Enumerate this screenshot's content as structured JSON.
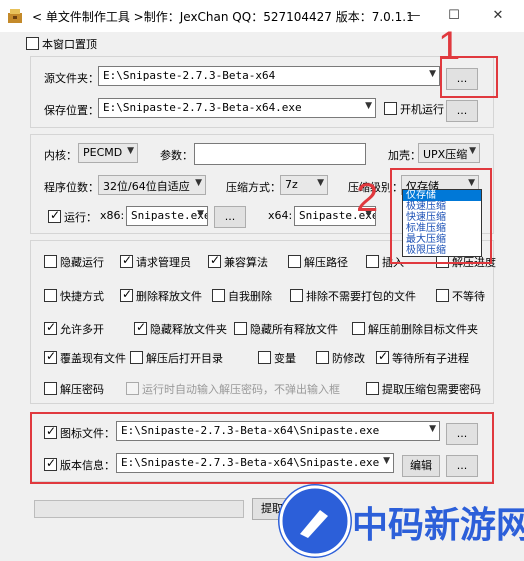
{
  "window": {
    "title": "< 单文件制作工具 >制作：JexChan  QQ：527104427  版本：7.0.1.1",
    "minimize": "—",
    "maximize": "☐",
    "close": "✕"
  },
  "top_option": {
    "label": "本窗口置顶",
    "checked": false
  },
  "source": {
    "label": "源文件夹：",
    "value": "E:\\Snipaste-2.7.3-Beta-x64",
    "browse": "..."
  },
  "save": {
    "label": "保存位置：",
    "value": "E:\\Snipaste-2.7.3-Beta-x64.exe",
    "autorun_label": "开机运行",
    "browse": "..."
  },
  "kernel": {
    "label": "内核：",
    "value": "PECMD"
  },
  "params": {
    "label": "参数：",
    "value": ""
  },
  "shell": {
    "label": "加壳：",
    "value": "UPX压缩"
  },
  "bits": {
    "label": "程序位数：",
    "value": "32位/64位自适应"
  },
  "compress_method": {
    "label": "压缩方式：",
    "value": "7z"
  },
  "compress_level": {
    "label": "压缩级别：",
    "value": "仅存储",
    "options": [
      "仅存储",
      "极速压缩",
      "快速压缩",
      "标准压缩",
      "最大压缩",
      "极限压缩"
    ],
    "selected_index": 0
  },
  "run": {
    "label": "运行：",
    "checked": true,
    "x86_label": "x86:",
    "x86_value": "Snipaste.exe",
    "x64_label": "x64:",
    "x64_value": "Snipaste.exe",
    "browse": "..."
  },
  "options": [
    {
      "label": "隐藏运行",
      "checked": false
    },
    {
      "label": "请求管理员",
      "checked": true
    },
    {
      "label": "兼容算法",
      "checked": true
    },
    {
      "label": "解压路径",
      "checked": false
    },
    {
      "label": "插入",
      "checked": false
    },
    {
      "label": "解压进度",
      "checked": false
    },
    {
      "label": "快捷方式",
      "checked": false
    },
    {
      "label": "删除释放文件",
      "checked": true
    },
    {
      "label": "自我删除",
      "checked": false
    },
    {
      "label": "排除不需要打包的文件",
      "checked": false
    },
    {
      "label": "不等待",
      "checked": false
    },
    {
      "label": "允许多开",
      "checked": true
    },
    {
      "label": "隐藏释放文件夹",
      "checked": true
    },
    {
      "label": "隐藏所有释放文件",
      "checked": false
    },
    {
      "label": "解压前删除目标文件夹",
      "checked": false
    },
    {
      "label": "覆盖现有文件",
      "checked": true
    },
    {
      "label": "解压后打开目录",
      "checked": false
    },
    {
      "label": "变量",
      "checked": false
    },
    {
      "label": "防修改",
      "checked": false
    },
    {
      "label": "等待所有子进程",
      "checked": true
    },
    {
      "label": "解压密码",
      "checked": false
    },
    {
      "label": "运行时自动输入解压密码，不弹出输入框",
      "checked": false,
      "disabled": true
    },
    {
      "label": "提取压缩包需要密码",
      "checked": false
    }
  ],
  "icon_file": {
    "label": "图标文件：",
    "checked": true,
    "value": "E:\\Snipaste-2.7.3-Beta-x64\\Snipaste.exe",
    "browse": "..."
  },
  "version_info": {
    "label": "版本信息：",
    "checked": true,
    "value": "E:\\Snipaste-2.7.3-Beta-x64\\Snipaste.exe",
    "edit": "编辑",
    "browse": "..."
  },
  "footer": {
    "partial_button": "提取"
  },
  "annotations": {
    "one": "1",
    "two": "2"
  },
  "watermark": {
    "text": "中码新游网"
  },
  "colors": {
    "accent": "#e0393e",
    "selection": "#0078d7",
    "watermark": "#2c5fd9"
  }
}
